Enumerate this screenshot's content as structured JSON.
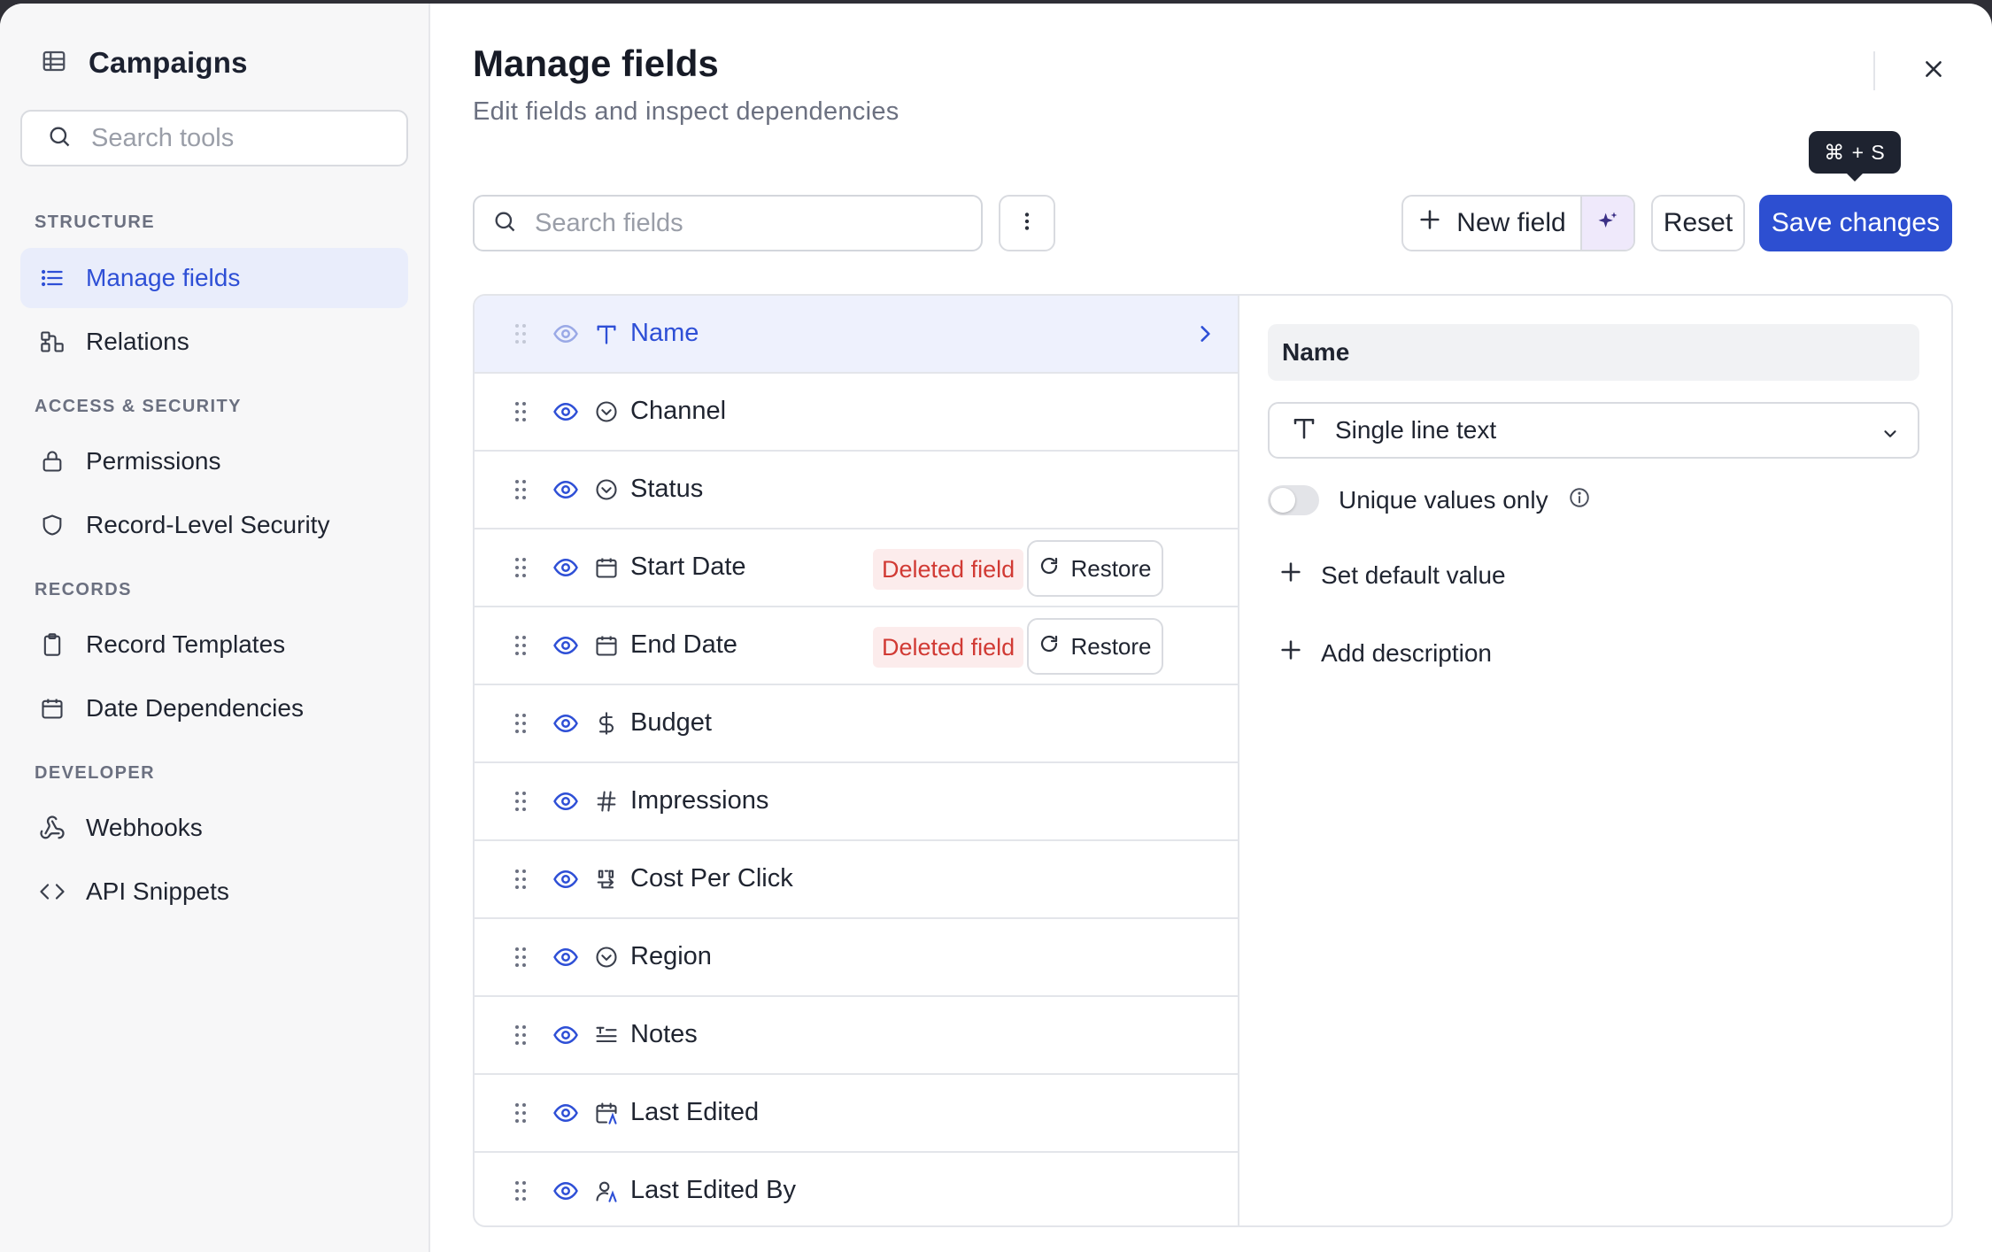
{
  "sidebar": {
    "title": "Campaigns",
    "search_placeholder": "Search tools",
    "sections": [
      {
        "label": "STRUCTURE"
      },
      {
        "label": "ACCESS & SECURITY"
      },
      {
        "label": "RECORDS"
      },
      {
        "label": "DEVELOPER"
      }
    ],
    "items": [
      {
        "label": "Manage fields",
        "icon": "list-icon",
        "active": true
      },
      {
        "label": "Relations",
        "icon": "relations-icon"
      },
      {
        "label": "Permissions",
        "icon": "lock-icon"
      },
      {
        "label": "Record-Level Security",
        "icon": "shield-icon"
      },
      {
        "label": "Record Templates",
        "icon": "clipboard-icon"
      },
      {
        "label": "Date Dependencies",
        "icon": "calendar-icon"
      },
      {
        "label": "Webhooks",
        "icon": "webhook-icon"
      },
      {
        "label": "API Snippets",
        "icon": "code-icon"
      }
    ]
  },
  "header": {
    "title": "Manage fields",
    "subtitle": "Edit fields and inspect dependencies"
  },
  "toolbar": {
    "search_placeholder": "Search fields",
    "new_field_label": "New field",
    "reset_label": "Reset",
    "save_label": "Save changes",
    "save_shortcut": "⌘ + S"
  },
  "fields": [
    {
      "name": "Name",
      "type_icon": "text-icon",
      "selected": true
    },
    {
      "name": "Channel",
      "type_icon": "select-icon"
    },
    {
      "name": "Status",
      "type_icon": "select-icon"
    },
    {
      "name": "Start Date",
      "type_icon": "calendar-icon",
      "deleted": true
    },
    {
      "name": "End Date",
      "type_icon": "calendar-icon",
      "deleted": true
    },
    {
      "name": "Budget",
      "type_icon": "dollar-icon"
    },
    {
      "name": "Impressions",
      "type_icon": "hash-icon"
    },
    {
      "name": "Cost Per Click",
      "type_icon": "formula-icon"
    },
    {
      "name": "Region",
      "type_icon": "select-icon"
    },
    {
      "name": "Notes",
      "type_icon": "long-text-icon"
    },
    {
      "name": "Last Edited",
      "type_icon": "calendar-edit-icon"
    },
    {
      "name": "Last Edited By",
      "type_icon": "user-edit-icon"
    }
  ],
  "deleted_badge": "Deleted field",
  "restore_label": "Restore",
  "details": {
    "field_name": "Name",
    "field_type": "Single line text",
    "unique_label": "Unique values only",
    "unique_enabled": false,
    "set_default_label": "Set default value",
    "add_description_label": "Add description"
  },
  "colors": {
    "accent": "#2d4fd1",
    "selected_row": "#eef1fd",
    "deleted_text": "#d13a34",
    "deleted_bg": "#fcecec"
  }
}
